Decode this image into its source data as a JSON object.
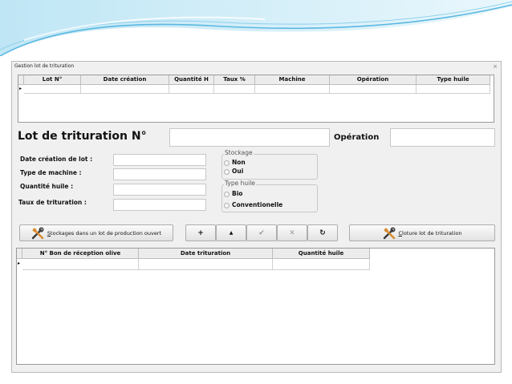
{
  "window": {
    "title": "Gestion lot de trituration",
    "close_glyph": "×"
  },
  "lots_grid": {
    "columns": [
      "Lot N°",
      "Date création",
      "Quantité H",
      "Taux %",
      "Machine",
      "Opération",
      "Type huile"
    ],
    "row_marker": "▸"
  },
  "header": {
    "title": "Lot de trituration N°",
    "operation_label": "Opération",
    "lot_number": "",
    "operation_value": ""
  },
  "form": {
    "date_label": "Date création de lot :",
    "machine_label": "Type de machine :",
    "quantite_label": "Quantité huile :",
    "taux_label": "Taux de trituration :",
    "date_value": "",
    "machine_value": "",
    "quantite_value": "",
    "taux_value": ""
  },
  "stockage": {
    "title": "Stockage",
    "options": [
      "Non",
      "Oui"
    ]
  },
  "type_huile": {
    "title": "Type huile",
    "options": [
      "Bio",
      "Conventionelle"
    ]
  },
  "buttons": {
    "stockages": {
      "underlined": "S",
      "rest": "tockages dans un lot de production ouvert"
    },
    "cloture": {
      "underlined": "C",
      "rest": "loture  lot de trituration"
    },
    "nav": {
      "add": "+",
      "up": "▲",
      "validate": "✔",
      "cancel": "✕",
      "refresh": "↻"
    }
  },
  "reception_grid": {
    "columns": [
      "N° Bon de réception olive",
      "Date trituration",
      "Quantité huile"
    ],
    "row_marker": "▸"
  },
  "colors": {
    "banner_blue": "#5bb8e2",
    "window_bg": "#f0f0f0",
    "tool_orange": "#d9892e"
  }
}
